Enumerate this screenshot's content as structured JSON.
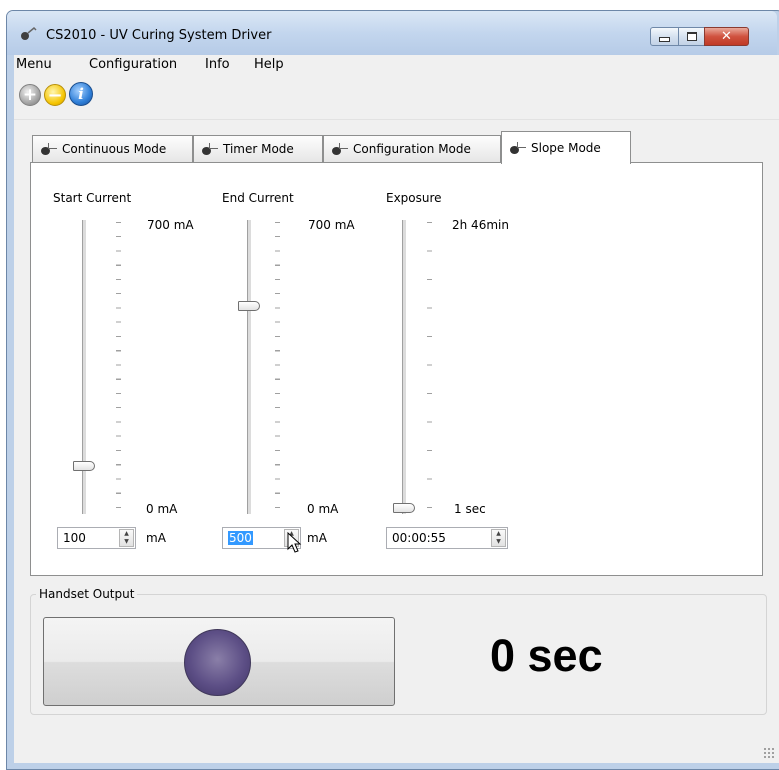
{
  "window": {
    "title": "CS2010 - UV Curing System Driver"
  },
  "menu": {
    "items": [
      "Menu",
      "Configuration",
      "Info",
      "Help"
    ]
  },
  "toolbar": {
    "icons": [
      "add-icon",
      "remove-icon",
      "info-icon"
    ]
  },
  "tabs": [
    {
      "label": "Continuous Mode"
    },
    {
      "label": "Timer Mode"
    },
    {
      "label": "Configuration Mode"
    },
    {
      "label": "Slope Mode",
      "active": true
    }
  ],
  "slope": {
    "start_current": {
      "label": "Start Current",
      "max": "700 mA",
      "min": "0 mA",
      "value": "100",
      "unit": "mA",
      "level": 0.143
    },
    "end_current": {
      "label": "End Current",
      "max": "700 mA",
      "min": "0 mA",
      "value": "500",
      "unit": "mA",
      "level": 0.714
    },
    "exposure": {
      "label": "Exposure",
      "max": "2h 46min",
      "min": "1 sec",
      "value": "00:00:55",
      "level": 0.0
    }
  },
  "handset": {
    "title": "Handset Output",
    "time": "0 sec",
    "led_color": "#5d4f86"
  }
}
